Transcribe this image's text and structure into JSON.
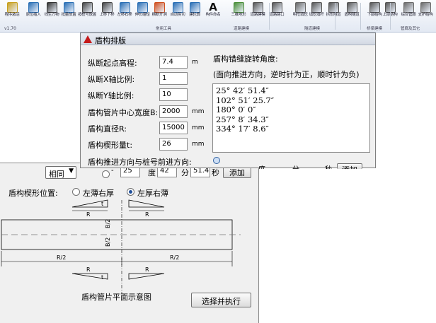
{
  "ribbon": {
    "version": "v1.70",
    "tools": [
      {
        "name": "program-activate",
        "label": "程序激活",
        "icon": "crown-icon"
      },
      {
        "name": "origin-insert",
        "label": "原位插入",
        "icon": "insert-icon"
      },
      {
        "name": "line-generate",
        "label": "线生万物",
        "icon": "curve-icon"
      },
      {
        "name": "batch-place",
        "label": "批量放置",
        "icon": "grid-icon"
      },
      {
        "name": "pile-place",
        "label": "按桩号放置",
        "icon": "function-icon"
      },
      {
        "name": "move-updown",
        "label": "上移下移",
        "icon": "arrow-updown-icon"
      },
      {
        "name": "flip-leftright",
        "label": "左移右移",
        "icon": "mirror-icon"
      },
      {
        "name": "stretch-shorten",
        "label": "伸长缩短",
        "icon": "stretch-icon"
      },
      {
        "name": "slice-open",
        "label": "横断开洞",
        "icon": "cut-icon"
      },
      {
        "name": "auto-clip",
        "label": "自动剪切",
        "icon": "clip-icon"
      },
      {
        "name": "create-material",
        "label": "建轮廓",
        "icon": "diamond-icon"
      },
      {
        "name": "component-annotate",
        "label": "构件命名",
        "icon": "letter-a-icon"
      },
      {
        "name": "3d-terrain",
        "label": "三维地形",
        "icon": "terrain-icon"
      },
      {
        "name": "road-build",
        "label": "道路建模",
        "icon": "road-icon"
      },
      {
        "name": "road-cross",
        "label": "道路路口",
        "icon": "crossroad-icon"
      },
      {
        "name": "openpit-cutfill",
        "label": "明挖填挖",
        "icon": "openpit-icon"
      },
      {
        "name": "cut-fill-pile",
        "label": "填挖填杆",
        "icon": "fill-icon"
      },
      {
        "name": "arc-tunnel",
        "label": "拱形隧道",
        "icon": "arch-icon"
      },
      {
        "name": "shield-tunnel",
        "label": "盾构隧道",
        "icon": "shield-tunnel-icon"
      },
      {
        "name": "lower-structure",
        "label": "下部结构",
        "icon": "lower-struct-icon"
      },
      {
        "name": "upper-structure",
        "label": "上部结构",
        "icon": "upper-struct-icon"
      },
      {
        "name": "comprehensive-pipe",
        "label": "综合管廊",
        "icon": "pipe-gallery-icon"
      },
      {
        "name": "support-structure",
        "label": "支护结构",
        "icon": "support-icon"
      }
    ],
    "groups": [
      "常用工具",
      "道路建模",
      "隧道建模",
      "桥梁建模",
      "管廊及其它"
    ]
  },
  "dialog": {
    "title": "盾构排版",
    "fields": [
      {
        "label": "纵断起点高程:",
        "value": "7.4",
        "unit": "m"
      },
      {
        "label": "纵断X轴比例:",
        "value": "1",
        "unit": ""
      },
      {
        "label": "纵断Y轴比例:",
        "value": "10",
        "unit": ""
      },
      {
        "label": "盾构管片中心宽度B:",
        "value": "2000",
        "unit": "mm"
      },
      {
        "label": "盾构直径R:",
        "value": "15000",
        "unit": "mm"
      },
      {
        "label": "盾构楔形量t:",
        "value": "26",
        "unit": "mm"
      }
    ],
    "rotation_title": "盾构错缝旋转角度:",
    "rotation_hint": "(面向推进方向，逆时针为正，顺时针为负)",
    "rotation_angles": [
      "25° 42′ 51.4″",
      "102° 51′ 25.7″",
      "180° 0′ 0″",
      "257° 8′ 34.3″",
      "334° 17′ 8.6″"
    ],
    "direction_label": "盾构推进方向与桩号前进方向:"
  },
  "panel": {
    "direction_select": "相同",
    "angle": {
      "deg": "25",
      "deg_unit": "度",
      "min": "42",
      "min_unit": "分",
      "sec": "51.4",
      "sec_unit": "秒"
    },
    "add_label": "添加",
    "hidden_row_peek": {
      "deg_unit": "度",
      "min_unit": "分",
      "sec_unit": "秒",
      "button": "添加"
    },
    "wedge_label": "盾构楔形位置:",
    "wedge_options": [
      {
        "label": "左薄右厚",
        "selected": false
      },
      {
        "label": "左厚右薄",
        "selected": true
      }
    ],
    "diagram": {
      "caption": "盾构管片平面示意图",
      "t": "t",
      "R": "R",
      "half_B": "B/2",
      "half_R": "R/2"
    },
    "execute_label": "选择并执行"
  }
}
